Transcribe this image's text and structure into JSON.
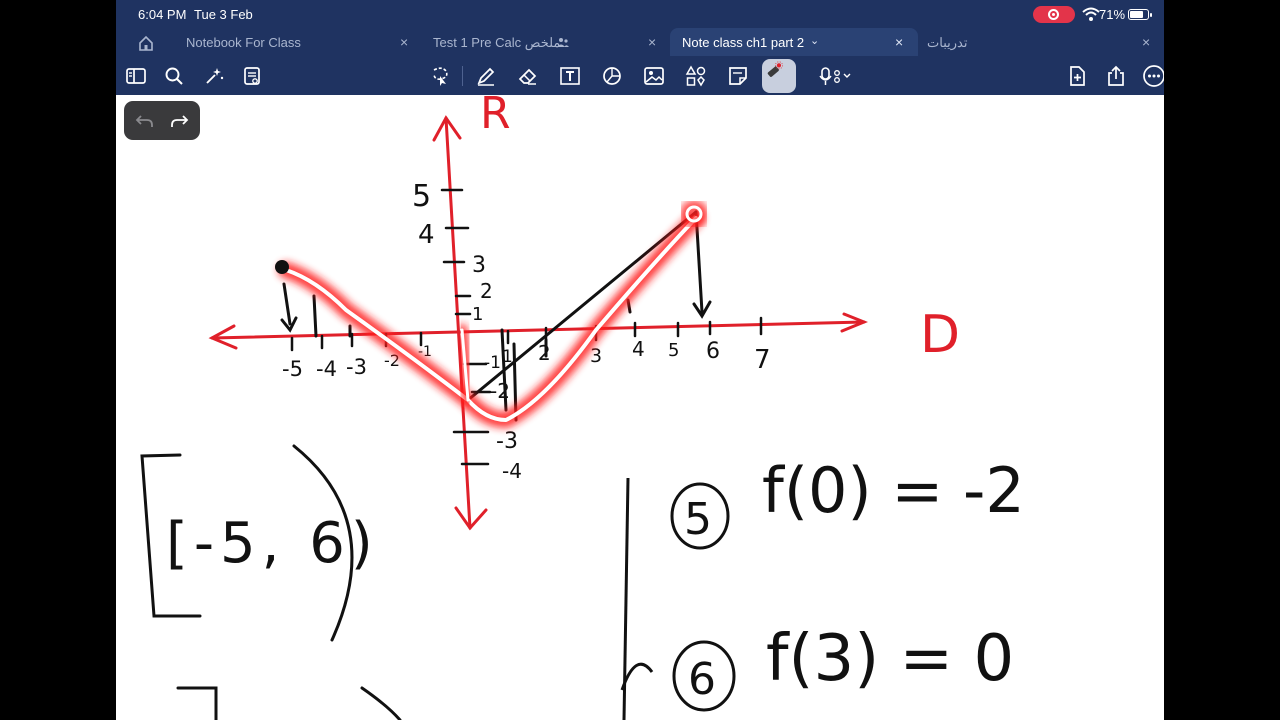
{
  "status_bar": {
    "time": "6:04 PM",
    "date": "Tue 3 Feb",
    "battery": "71%"
  },
  "tabs": [
    {
      "label": "Notebook For Class",
      "active": false
    },
    {
      "label": "Test 1 Pre Calc ملخص",
      "active": false
    },
    {
      "label": "Note class ch1 part 2",
      "active": true
    },
    {
      "label": "تدريبات",
      "active": false
    }
  ],
  "icons": {
    "home": "home-icon",
    "sidebar": "sidebar-icon",
    "search": "search-icon",
    "ai": "sparkle-icon",
    "doc": "document-icon",
    "lasso": "lasso-icon",
    "pen": "pen-icon",
    "eraser": "eraser-icon",
    "text": "text-box-icon",
    "shapes": "shapes-icon",
    "image": "image-icon",
    "elements": "elements-icon",
    "sticker": "sticker-icon",
    "laser": "laser-pointer-icon",
    "mic": "microphone-icon",
    "add_page": "add-page-icon",
    "share": "share-icon",
    "more": "more-icon"
  },
  "colors": {
    "toolbar_bg": "#1f3361",
    "ink_red": "#e0202a",
    "ink_black": "#111111",
    "glow": "#ff1a1a",
    "record": "#e3344a"
  },
  "canvas": {
    "axis_labels": {
      "y": "R",
      "x": "D"
    },
    "y_ticks": [
      "5",
      "4",
      "3",
      "2",
      "1",
      "-1",
      "-2",
      "-3",
      "-4"
    ],
    "x_ticks": [
      "-5",
      "-4",
      "-3",
      "-2",
      "-1",
      "1",
      "2",
      "3",
      "4",
      "5",
      "6",
      "7"
    ],
    "domain_text": "[-5, 6)",
    "notes": [
      {
        "number": "5",
        "text": "f(0) = -2"
      },
      {
        "number": "6",
        "text": "f(3) = 0"
      }
    ]
  }
}
